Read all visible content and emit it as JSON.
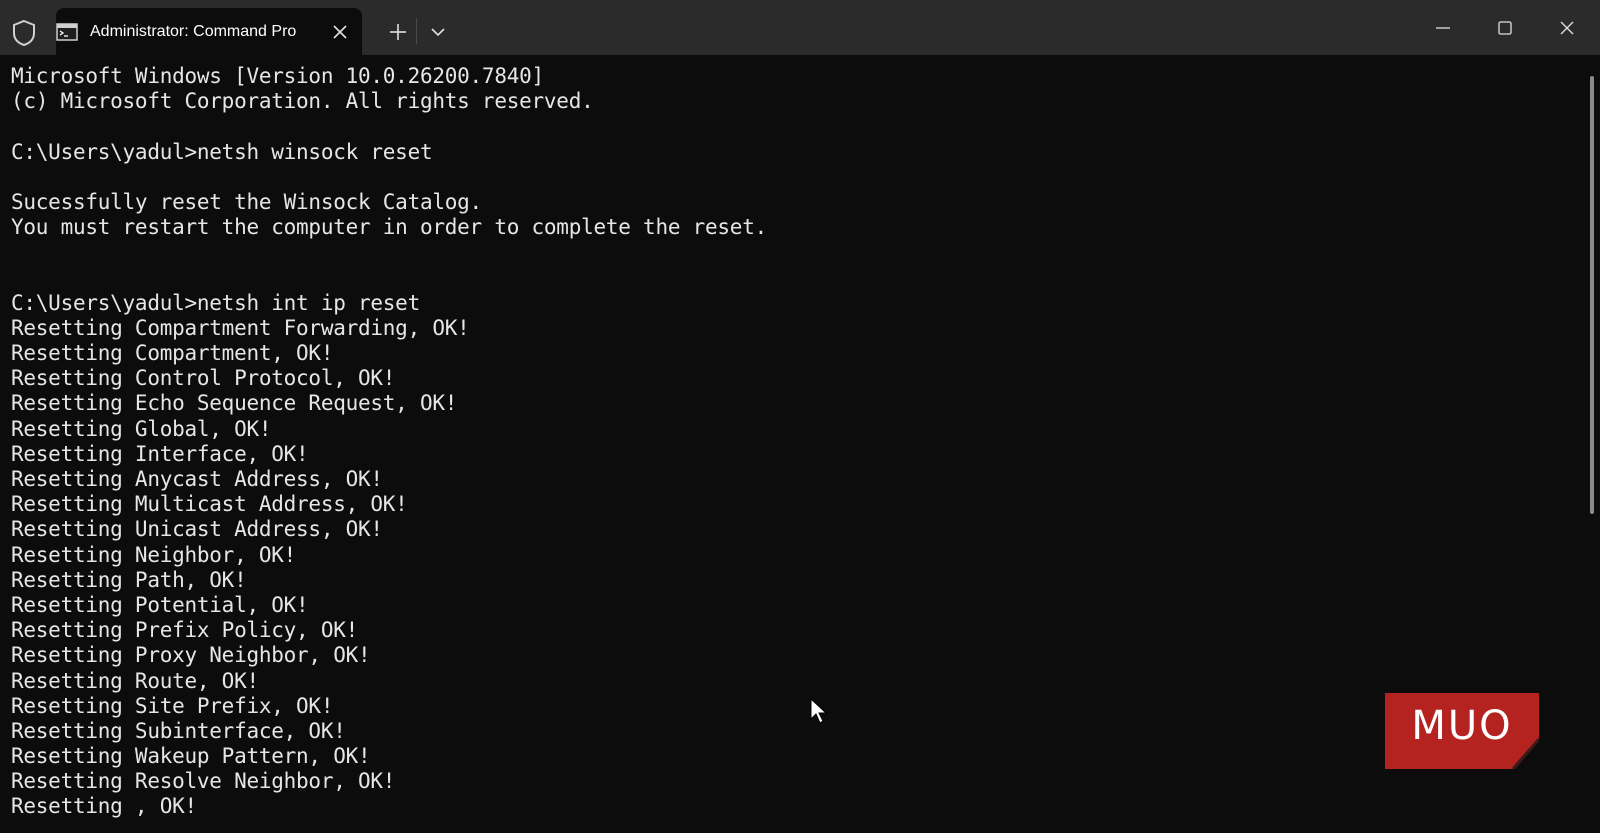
{
  "window": {
    "tab_title": "Administrator: Command Pro",
    "colors": {
      "titlebar": "#2b2b2b",
      "background": "#0c0c0c",
      "text": "#e6e6e6",
      "logo": "#b4231f"
    }
  },
  "terminal": {
    "lines": [
      "Microsoft Windows [Version 10.0.26200.7840]",
      "(c) Microsoft Corporation. All rights reserved.",
      "",
      "C:\\Users\\yadul>netsh winsock reset",
      "",
      "Sucessfully reset the Winsock Catalog.",
      "You must restart the computer in order to complete the reset.",
      "",
      "",
      "C:\\Users\\yadul>netsh int ip reset",
      "Resetting Compartment Forwarding, OK!",
      "Resetting Compartment, OK!",
      "Resetting Control Protocol, OK!",
      "Resetting Echo Sequence Request, OK!",
      "Resetting Global, OK!",
      "Resetting Interface, OK!",
      "Resetting Anycast Address, OK!",
      "Resetting Multicast Address, OK!",
      "Resetting Unicast Address, OK!",
      "Resetting Neighbor, OK!",
      "Resetting Path, OK!",
      "Resetting Potential, OK!",
      "Resetting Prefix Policy, OK!",
      "Resetting Proxy Neighbor, OK!",
      "Resetting Route, OK!",
      "Resetting Site Prefix, OK!",
      "Resetting Subinterface, OK!",
      "Resetting Wakeup Pattern, OK!",
      "Resetting Resolve Neighbor, OK!",
      "Resetting , OK!"
    ]
  },
  "icons": {
    "shield": "shield-icon",
    "tab": "command-prompt-icon",
    "close_tab": "close-icon",
    "new_tab": "plus-icon",
    "dropdown": "chevron-down-icon",
    "minimize": "minimize-icon",
    "maximize": "maximize-icon",
    "close_window": "close-icon",
    "pointer": "mouse-pointer-icon"
  },
  "watermark": {
    "text": "MUO"
  }
}
